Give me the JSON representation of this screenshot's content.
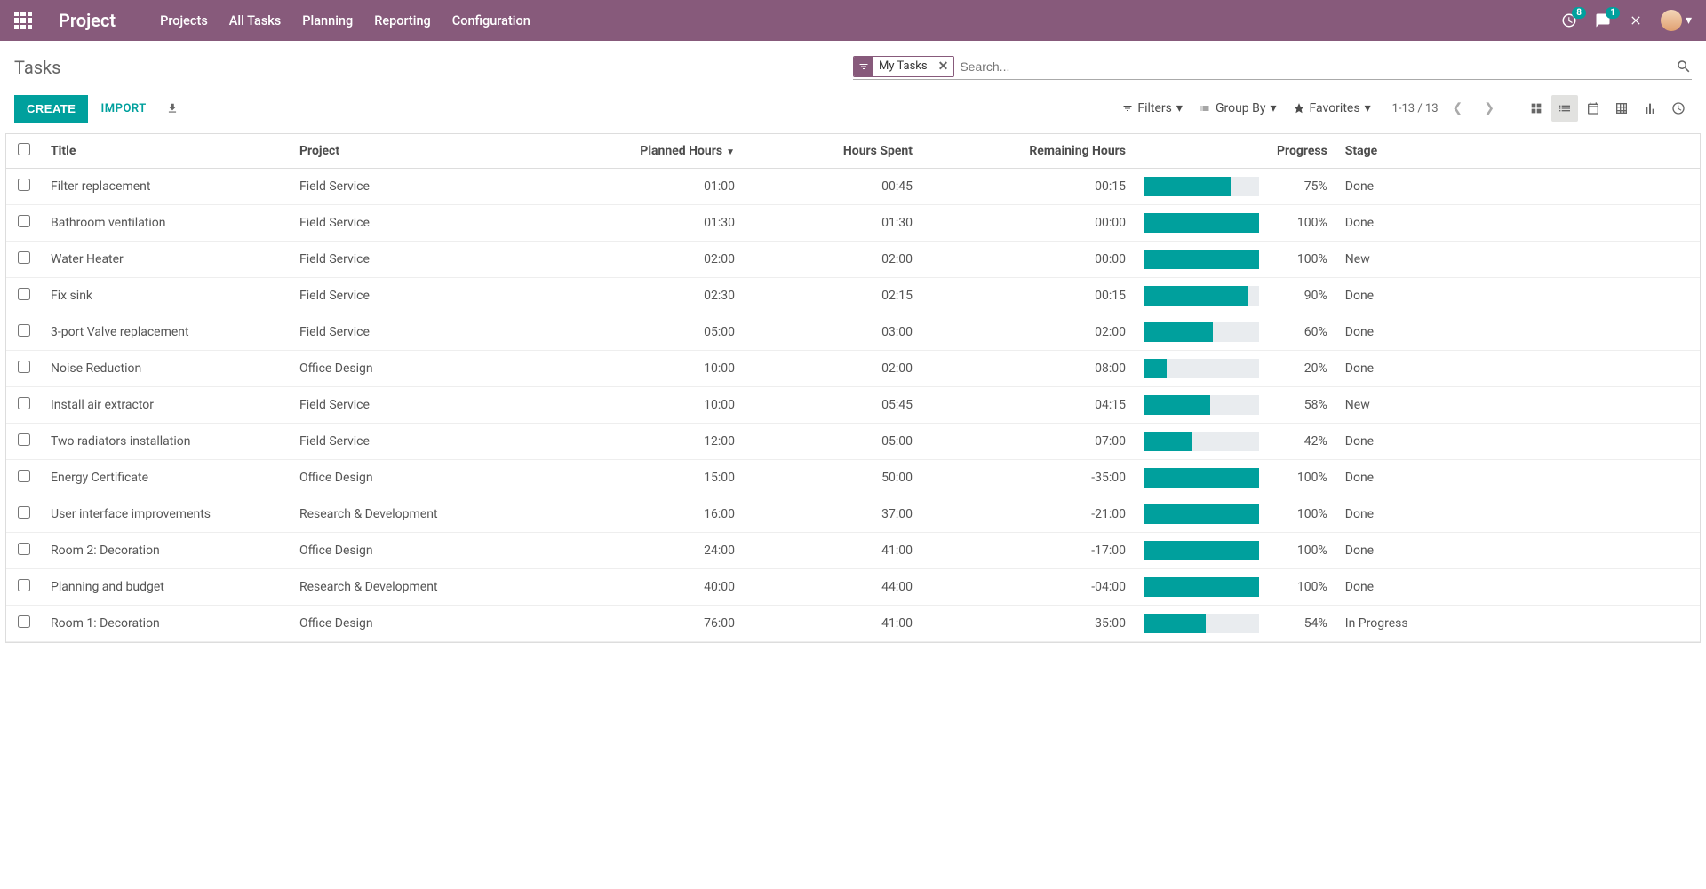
{
  "header": {
    "brand": "Project",
    "nav": [
      "Projects",
      "All Tasks",
      "Planning",
      "Reporting",
      "Configuration"
    ],
    "badges": {
      "clock": "8",
      "chat": "1"
    }
  },
  "breadcrumb": "Tasks",
  "search": {
    "facet_label": "My Tasks",
    "placeholder": "Search..."
  },
  "buttons": {
    "create": "CREATE",
    "import": "IMPORT",
    "filters": "Filters",
    "groupby": "Group By",
    "favorites": "Favorites"
  },
  "pager": "1-13 / 13",
  "columns": {
    "title": "Title",
    "project": "Project",
    "planned": "Planned Hours",
    "spent": "Hours Spent",
    "remaining": "Remaining Hours",
    "progress": "Progress",
    "stage": "Stage"
  },
  "rows": [
    {
      "title": "Filter replacement",
      "project": "Field Service",
      "planned": "01:00",
      "spent": "00:45",
      "remaining": "00:15",
      "pct": "75%",
      "pctN": 75,
      "stage": "Done"
    },
    {
      "title": "Bathroom ventilation",
      "project": "Field Service",
      "planned": "01:30",
      "spent": "01:30",
      "remaining": "00:00",
      "pct": "100%",
      "pctN": 100,
      "stage": "Done"
    },
    {
      "title": "Water Heater",
      "project": "Field Service",
      "planned": "02:00",
      "spent": "02:00",
      "remaining": "00:00",
      "pct": "100%",
      "pctN": 100,
      "stage": "New"
    },
    {
      "title": "Fix sink",
      "project": "Field Service",
      "planned": "02:30",
      "spent": "02:15",
      "remaining": "00:15",
      "pct": "90%",
      "pctN": 90,
      "stage": "Done"
    },
    {
      "title": "3-port Valve replacement",
      "project": "Field Service",
      "planned": "05:00",
      "spent": "03:00",
      "remaining": "02:00",
      "pct": "60%",
      "pctN": 60,
      "stage": "Done"
    },
    {
      "title": "Noise Reduction",
      "project": "Office Design",
      "planned": "10:00",
      "spent": "02:00",
      "remaining": "08:00",
      "pct": "20%",
      "pctN": 20,
      "stage": "Done"
    },
    {
      "title": "Install air extractor",
      "project": "Field Service",
      "planned": "10:00",
      "spent": "05:45",
      "remaining": "04:15",
      "pct": "58%",
      "pctN": 58,
      "stage": "New"
    },
    {
      "title": "Two radiators installation",
      "project": "Field Service",
      "planned": "12:00",
      "spent": "05:00",
      "remaining": "07:00",
      "pct": "42%",
      "pctN": 42,
      "stage": "Done"
    },
    {
      "title": "Energy Certificate",
      "project": "Office Design",
      "planned": "15:00",
      "spent": "50:00",
      "remaining": "-35:00",
      "pct": "100%",
      "pctN": 100,
      "stage": "Done"
    },
    {
      "title": "User interface improvements",
      "project": "Research & Development",
      "planned": "16:00",
      "spent": "37:00",
      "remaining": "-21:00",
      "pct": "100%",
      "pctN": 100,
      "stage": "Done"
    },
    {
      "title": "Room 2: Decoration",
      "project": "Office Design",
      "planned": "24:00",
      "spent": "41:00",
      "remaining": "-17:00",
      "pct": "100%",
      "pctN": 100,
      "stage": "Done"
    },
    {
      "title": "Planning and budget",
      "project": "Research & Development",
      "planned": "40:00",
      "spent": "44:00",
      "remaining": "-04:00",
      "pct": "100%",
      "pctN": 100,
      "stage": "Done"
    },
    {
      "title": "Room 1: Decoration",
      "project": "Office Design",
      "planned": "76:00",
      "spent": "41:00",
      "remaining": "35:00",
      "pct": "54%",
      "pctN": 54,
      "stage": "In Progress"
    }
  ]
}
